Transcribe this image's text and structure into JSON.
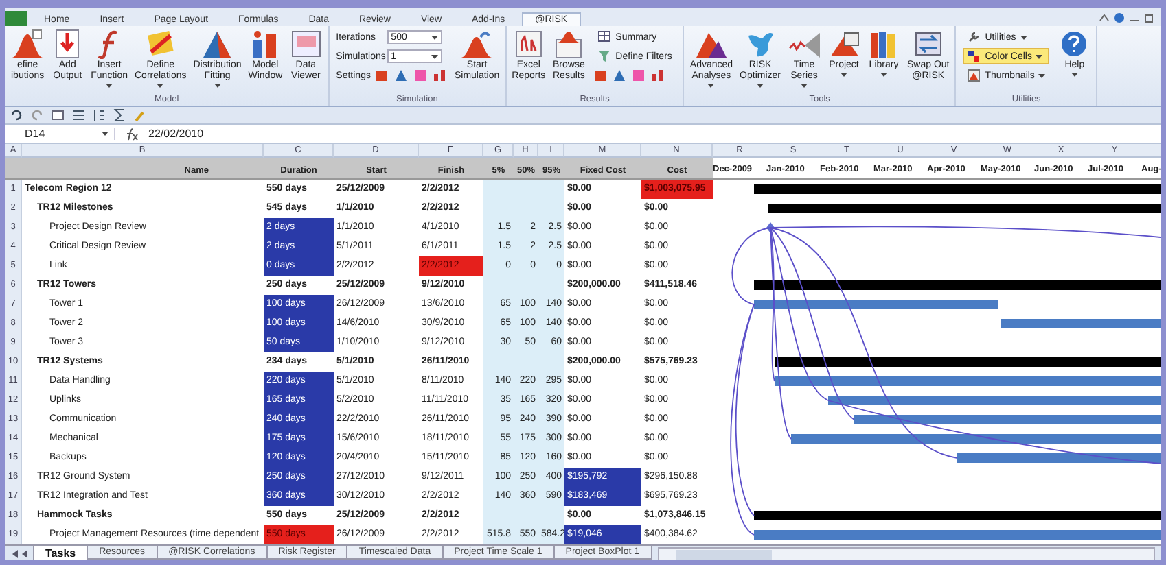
{
  "ribbon": {
    "tabs": [
      {
        "label": "Home",
        "selected": false
      },
      {
        "label": "Insert",
        "selected": false
      },
      {
        "label": "Page Layout",
        "selected": false
      },
      {
        "label": "Formulas",
        "selected": false
      },
      {
        "label": "Data",
        "selected": false
      },
      {
        "label": "Review",
        "selected": false
      },
      {
        "label": "View",
        "selected": false
      },
      {
        "label": "Add-Ins",
        "selected": false
      },
      {
        "label": "@RISK",
        "selected": true
      }
    ],
    "groups": [
      {
        "label": "Model",
        "items": [
          {
            "kind": "large",
            "lines": [
              "efine",
              "ibutions"
            ],
            "dropdown": false
          },
          {
            "kind": "large",
            "lines": [
              "Add",
              "Output"
            ],
            "dropdown": false
          },
          {
            "kind": "large",
            "lines": [
              "Insert",
              "Function"
            ],
            "dropdown": true
          },
          {
            "kind": "large",
            "lines": [
              "Define",
              "Correlations"
            ],
            "dropdown": true
          },
          {
            "kind": "large",
            "lines": [
              "Distribution",
              "Fitting"
            ],
            "dropdown": true
          },
          {
            "kind": "large",
            "lines": [
              "Model",
              "Window"
            ],
            "dropdown": false
          },
          {
            "kind": "large",
            "lines": [
              "Data",
              "Viewer"
            ],
            "dropdown": false
          }
        ]
      },
      {
        "label": "Simulation",
        "items": [
          {
            "kind": "field",
            "label": "Iterations",
            "value": "500"
          },
          {
            "kind": "field",
            "label": "Simulations",
            "value": "1"
          },
          {
            "kind": "icons",
            "label": "Settings"
          },
          {
            "kind": "large",
            "lines": [
              "Start",
              "Simulation"
            ],
            "dropdown": false
          }
        ]
      },
      {
        "label": "Results",
        "items": [
          {
            "kind": "large",
            "lines": [
              "Excel",
              "Reports"
            ],
            "dropdown": false
          },
          {
            "kind": "large",
            "lines": [
              "Browse",
              "Results"
            ],
            "dropdown": false
          },
          {
            "kind": "small",
            "label": "Summary",
            "dropdown": false,
            "selected": false
          },
          {
            "kind": "small",
            "label": "Define Filters",
            "dropdown": false,
            "selected": false
          },
          {
            "kind": "icons"
          }
        ]
      },
      {
        "label": "Tools",
        "items": [
          {
            "kind": "large",
            "lines": [
              "Advanced",
              "Analyses"
            ],
            "dropdown": true
          },
          {
            "kind": "large",
            "lines": [
              "RISK",
              "Optimizer"
            ],
            "dropdown": true
          },
          {
            "kind": "large",
            "lines": [
              "Time",
              "Series"
            ],
            "dropdown": true
          },
          {
            "kind": "large",
            "lines": [
              "Project"
            ],
            "dropdown": true
          },
          {
            "kind": "large",
            "lines": [
              "Library"
            ],
            "dropdown": true
          },
          {
            "kind": "large",
            "lines": [
              "Swap Out",
              "@RISK"
            ],
            "dropdown": false
          }
        ]
      },
      {
        "label": "Utilities",
        "items": [
          {
            "kind": "small",
            "label": "Utilities",
            "dropdown": true,
            "selected": false
          },
          {
            "kind": "small",
            "label": "Color Cells",
            "dropdown": true,
            "selected": true
          },
          {
            "kind": "small",
            "label": "Thumbnails",
            "dropdown": true,
            "selected": false
          },
          {
            "kind": "large",
            "lines": [
              "Help"
            ],
            "dropdown": true
          }
        ]
      }
    ]
  },
  "formula_bar": {
    "cell": "D14",
    "value": "22/02/2010"
  },
  "table": {
    "column_letters": [
      "A",
      "B",
      "C",
      "D",
      "E",
      "G",
      "H",
      "I",
      "M",
      "N",
      "R",
      "S",
      "T",
      "U",
      "V",
      "W",
      "X",
      "Y"
    ],
    "columns": [
      "Name",
      "Duration",
      "Start",
      "Finish",
      "5%",
      "50%",
      "95%",
      "Fixed Cost",
      "Cost"
    ],
    "months": [
      "Dec-2009",
      "Jan-2010",
      "Feb-2010",
      "Mar-2010",
      "Apr-2010",
      "May-2010",
      "Jun-2010",
      "Jul-2010",
      "Aug-"
    ],
    "rows": [
      {
        "num": "1",
        "name": "Telecom Region 12",
        "duration": "550 days",
        "start": "25/12/2009",
        "finish": "2/2/2012",
        "fixed_cost": "$0.00",
        "cost": {
          "value": "$1,003,075.95",
          "color": "#e5201c"
        },
        "children": [
          {
            "num": "2",
            "name": "TR12 Milestones",
            "duration": "545 days",
            "start": "1/1/2010",
            "finish": "2/2/2012",
            "fixed_cost": "$0.00",
            "cost": "$0.00",
            "children": [
              {
                "num": "3",
                "name": "Project Design Review",
                "duration": {
                  "value": "2 days",
                  "color": "#2a3aa8"
                },
                "start": "1/1/2010",
                "finish": "4/1/2010",
                "p5": "1.5",
                "p50": "2",
                "p95": "2.5",
                "fixed_cost": "$0.00",
                "cost": "$0.00"
              },
              {
                "num": "4",
                "name": "Critical Design Review",
                "duration": {
                  "value": "2 days",
                  "color": "#2a3aa8"
                },
                "start": "5/1/2011",
                "finish": "6/1/2011",
                "p5": "1.5",
                "p50": "2",
                "p95": "2.5",
                "fixed_cost": "$0.00",
                "cost": "$0.00"
              },
              {
                "num": "5",
                "name": "Link",
                "duration": {
                  "value": "0 days",
                  "color": "#2a3aa8"
                },
                "start": "2/2/2012",
                "finish": {
                  "value": "2/2/2012",
                  "color": "#e5201c"
                },
                "p5": "0",
                "p50": "0",
                "p95": "0",
                "fixed_cost": "$0.00",
                "cost": "$0.00"
              }
            ]
          },
          {
            "num": "6",
            "name": "TR12 Towers",
            "duration": "250 days",
            "start": "25/12/2009",
            "finish": "9/12/2010",
            "fixed_cost": "$200,000.00",
            "cost": "$411,518.46",
            "children": [
              {
                "num": "7",
                "name": "Tower 1",
                "duration": {
                  "value": "100 days",
                  "color": "#2a3aa8"
                },
                "start": "26/12/2009",
                "finish": "13/6/2010",
                "p5": "65",
                "p50": "100",
                "p95": "140",
                "fixed_cost": "$0.00",
                "cost": "$0.00"
              },
              {
                "num": "8",
                "name": "Tower 2",
                "duration": {
                  "value": "100 days",
                  "color": "#2a3aa8"
                },
                "start": "14/6/2010",
                "finish": "30/9/2010",
                "p5": "65",
                "p50": "100",
                "p95": "140",
                "fixed_cost": "$0.00",
                "cost": "$0.00"
              },
              {
                "num": "9",
                "name": "Tower 3",
                "duration": {
                  "value": "50 days",
                  "color": "#2a3aa8"
                },
                "start": "1/10/2010",
                "finish": "9/12/2010",
                "p5": "30",
                "p50": "50",
                "p95": "60",
                "fixed_cost": "$0.00",
                "cost": "$0.00"
              }
            ]
          },
          {
            "num": "10",
            "name": "TR12 Systems",
            "duration": "234 days",
            "start": "5/1/2010",
            "finish": "26/11/2010",
            "fixed_cost": "$200,000.00",
            "cost": "$575,769.23",
            "children": [
              {
                "num": "11",
                "name": "Data Handling",
                "duration": {
                  "value": "220 days",
                  "color": "#2a3aa8"
                },
                "start": "5/1/2010",
                "finish": "8/11/2010",
                "p5": "140",
                "p50": "220",
                "p95": "295",
                "fixed_cost": "$0.00",
                "cost": "$0.00"
              },
              {
                "num": "12",
                "name": "Uplinks",
                "duration": {
                  "value": "165 days",
                  "color": "#2a3aa8"
                },
                "start": "5/2/2010",
                "finish": "11/11/2010",
                "p5": "35",
                "p50": "165",
                "p95": "320",
                "fixed_cost": "$0.00",
                "cost": "$0.00"
              },
              {
                "num": "13",
                "name": "Communication",
                "duration": {
                  "value": "240 days",
                  "color": "#2a3aa8"
                },
                "start": "22/2/2010",
                "finish": "26/11/2010",
                "p5": "95",
                "p50": "240",
                "p95": "390",
                "fixed_cost": "$0.00",
                "cost": "$0.00"
              },
              {
                "num": "14",
                "name": "Mechanical",
                "duration": {
                  "value": "175 days",
                  "color": "#2a3aa8"
                },
                "start": "15/6/2010",
                "finish": "18/11/2010",
                "p5": "55",
                "p50": "175",
                "p95": "300",
                "fixed_cost": "$0.00",
                "cost": "$0.00"
              },
              {
                "num": "15",
                "name": "Backups",
                "duration": {
                  "value": "120 days",
                  "color": "#2a3aa8"
                },
                "start": "20/4/2010",
                "finish": "15/11/2010",
                "p5": "85",
                "p50": "120",
                "p95": "160",
                "fixed_cost": "$0.00",
                "cost": "$0.00"
              }
            ]
          },
          {
            "num": "16",
            "name": "TR12 Ground System",
            "duration": {
              "value": "250 days",
              "color": "#2a3aa8"
            },
            "start": "27/12/2010",
            "finish": "9/12/2011",
            "p5": "100",
            "p50": "250",
            "p95": "400",
            "fixed_cost": {
              "value": "$195,792",
              "color": "#2a3aa8"
            },
            "cost": "$296,150.88"
          },
          {
            "num": "17",
            "name": "TR12 Integration and Test",
            "duration": {
              "value": "360 days",
              "color": "#2a3aa8"
            },
            "start": "30/12/2010",
            "finish": "2/2/2012",
            "p5": "140",
            "p50": "360",
            "p95": "590",
            "fixed_cost": {
              "value": "$183,469",
              "color": "#2a3aa8"
            },
            "cost": "$695,769.23"
          },
          {
            "num": "18",
            "name": "Hammock Tasks",
            "duration": "550 days",
            "start": "25/12/2009",
            "finish": "2/2/2012",
            "fixed_cost": "$0.00",
            "cost": "$1,073,846.15",
            "children": [
              {
                "num": "19",
                "name": "Project Management Resources (time dependent",
                "duration": {
                  "value": "550 days",
                  "color": "#e5201c"
                },
                "start": "26/12/2009",
                "finish": "2/2/2012",
                "p5": "515.8",
                "p50": "550",
                "p95": "584.2",
                "fixed_cost": {
                  "value": "$19,046",
                  "color": "#2a3aa8"
                },
                "cost": "$400,384.62"
              }
            ]
          }
        ]
      }
    ]
  },
  "sheet_tabs": [
    {
      "label": "Tasks",
      "selected": true
    },
    {
      "label": "Resources",
      "selected": false
    },
    {
      "label": "@RISK Correlations",
      "selected": false
    },
    {
      "label": "Risk Register",
      "selected": false
    },
    {
      "label": "Timescaled Data",
      "selected": false
    },
    {
      "label": "Project Time Scale 1",
      "selected": false
    },
    {
      "label": "Project BoxPlot 1",
      "selected": false
    }
  ]
}
